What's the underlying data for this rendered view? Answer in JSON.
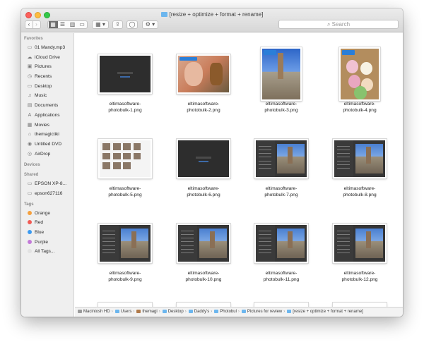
{
  "window": {
    "title": "[resize + optimize + format + rename]"
  },
  "toolbar": {
    "back": "‹",
    "forward": "›",
    "view_icons": "▦",
    "view_list": "☰",
    "view_columns": "▥",
    "view_gallery": "▭",
    "arrange": "▦ ▾",
    "share": "⇪",
    "tags": "◯",
    "action": "⚙ ▾",
    "search_placeholder": "Search"
  },
  "sidebar": {
    "favorites_header": "Favorites",
    "favorites": [
      {
        "label": "01 Mandy.mp3",
        "icon": "▭"
      },
      {
        "label": "iCloud Drive",
        "icon": "☁"
      },
      {
        "label": "Pictures",
        "icon": "▣"
      },
      {
        "label": "Recents",
        "icon": "◷"
      },
      {
        "label": "Desktop",
        "icon": "▭"
      },
      {
        "label": "Music",
        "icon": "♫"
      },
      {
        "label": "Documents",
        "icon": "▤"
      },
      {
        "label": "Applications",
        "icon": "A"
      },
      {
        "label": "Movies",
        "icon": "▦"
      },
      {
        "label": "themagictiki",
        "icon": "⌂"
      },
      {
        "label": "Untitled DVD",
        "icon": "◉"
      },
      {
        "label": "AirDrop",
        "icon": "◎"
      }
    ],
    "devices_header": "Devices",
    "shared_header": "Shared",
    "shared": [
      {
        "label": "EPSON XP-8...",
        "icon": "▭"
      },
      {
        "label": "epson627116",
        "icon": "▭"
      }
    ],
    "tags_header": "Tags",
    "tags": [
      {
        "label": "Orange",
        "color": "#f5a03d"
      },
      {
        "label": "Red",
        "color": "#f15b54"
      },
      {
        "label": "Blue",
        "color": "#3b9af0"
      },
      {
        "label": "Purple",
        "color": "#c27ad8"
      },
      {
        "label": "All Tags...",
        "color": "#e2e2e2"
      }
    ]
  },
  "files": [
    {
      "line1": "eltimasoftware-",
      "line2": "photobulk-1.png",
      "kind": "dark-ui",
      "orient": "landscape"
    },
    {
      "line1": "eltimasoftware-",
      "line2": "photobulk-2.png",
      "kind": "person",
      "orient": "landscape"
    },
    {
      "line1": "eltimasoftware-",
      "line2": "photobulk-3.png",
      "kind": "church",
      "orient": "portrait"
    },
    {
      "line1": "eltimasoftware-",
      "line2": "photobulk-4.png",
      "kind": "donuts",
      "orient": "portrait"
    },
    {
      "line1": "eltimasoftware-",
      "line2": "photobulk-5.png",
      "kind": "grid-ui",
      "orient": "landscape"
    },
    {
      "line1": "eltimasoftware-",
      "line2": "photobulk-6.png",
      "kind": "dark-ui",
      "orient": "landscape"
    },
    {
      "line1": "eltimasoftware-",
      "line2": "photobulk-7.png",
      "kind": "app-ui",
      "orient": "landscape"
    },
    {
      "line1": "eltimasoftware-",
      "line2": "photobulk-8.png",
      "kind": "app-ui",
      "orient": "landscape"
    },
    {
      "line1": "eltimasoftware-",
      "line2": "photobulk-9.png",
      "kind": "app-ui",
      "orient": "landscape"
    },
    {
      "line1": "eltimasoftware-",
      "line2": "photobulk-10.png",
      "kind": "app-ui",
      "orient": "landscape"
    },
    {
      "line1": "eltimasoftware-",
      "line2": "photobulk-11.png",
      "kind": "app-ui",
      "orient": "landscape"
    },
    {
      "line1": "eltimasoftware-",
      "line2": "photobulk-12.png",
      "kind": "app-ui",
      "orient": "landscape"
    }
  ],
  "pathbar": [
    {
      "label": "Macintosh HD",
      "icon": "drive"
    },
    {
      "label": "Users",
      "icon": "folder"
    },
    {
      "label": "themagi",
      "icon": "home"
    },
    {
      "label": "Desktop",
      "icon": "folder"
    },
    {
      "label": "Daddy's",
      "icon": "folder"
    },
    {
      "label": "Photobul",
      "icon": "folder"
    },
    {
      "label": "Pictures for review",
      "icon": "folder"
    },
    {
      "label": "[resize + optimize + format + rename]",
      "icon": "folder"
    }
  ]
}
